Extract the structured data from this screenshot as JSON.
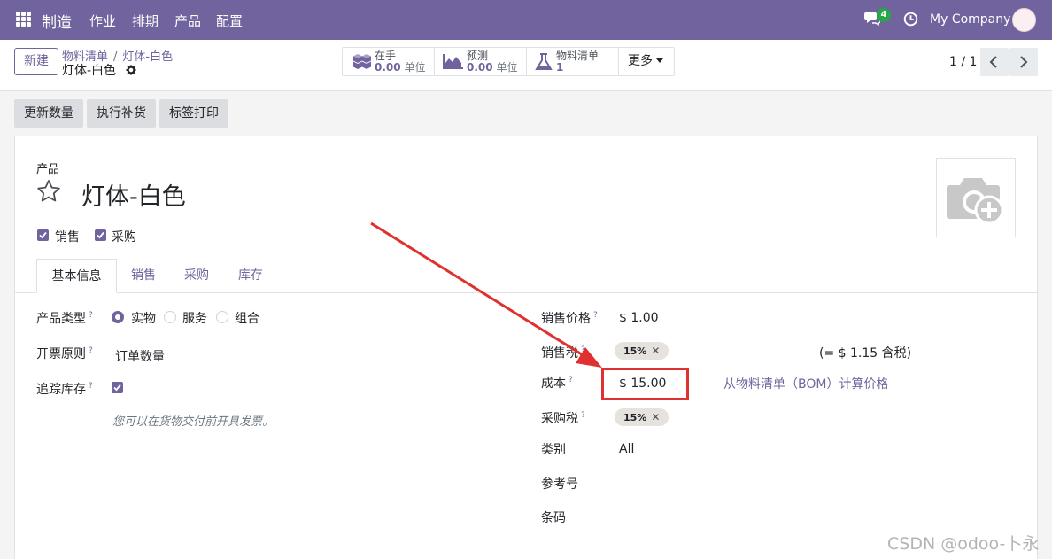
{
  "navbar": {
    "brand": "制造",
    "menu": [
      "作业",
      "排期",
      "产品",
      "配置"
    ],
    "chat_count": "4",
    "company": "My Company"
  },
  "control": {
    "new_label": "新建",
    "breadcrumb": [
      "物料清单",
      "灯体-白色"
    ],
    "record_title": "灯体-白色",
    "smart_buttons": [
      {
        "label": "在手",
        "value": "0.00",
        "unit": "单位",
        "icon": "cubes-icon"
      },
      {
        "label": "预测",
        "value": "0.00",
        "unit": "单位",
        "icon": "area-chart-icon"
      },
      {
        "label": "物料清单",
        "value": "1",
        "unit": "",
        "icon": "flask-icon"
      }
    ],
    "more_label": "更多",
    "pager": "1 / 1"
  },
  "actions": [
    "更新数量",
    "执行补货",
    "标签打印"
  ],
  "form": {
    "product_label": "产品",
    "product_name": "灯体-白色",
    "sale_ok_label": "销售",
    "purchase_ok_label": "采购",
    "tabs": [
      "基本信息",
      "销售",
      "采购",
      "库存"
    ],
    "left": {
      "type_label": "产品类型",
      "type_options": [
        "实物",
        "服务",
        "组合"
      ],
      "type_selected": "实物",
      "invoice_label": "开票原则",
      "invoice_value": "订单数量",
      "track_label": "追踪库存",
      "hint": "您可以在货物交付前开具发票。"
    },
    "right": {
      "price_label": "销售价格",
      "price_value": "$ 1.00",
      "sale_tax_label": "销售税",
      "sale_tax_tag": "15%",
      "sale_tax_incl": "(= $ 1.15 含税)",
      "cost_label": "成本",
      "cost_value": "$ 15.00",
      "bom_link": "从物料清单（BOM）计算价格",
      "purchase_tax_label": "采购税",
      "purchase_tax_tag": "15%",
      "category_label": "类别",
      "category_value": "All",
      "ref_label": "参考号",
      "barcode_label": "条码"
    }
  },
  "watermark": "CSDN @odoo-卜永",
  "colors": {
    "brand": "#71639e",
    "annotation": "#e03131"
  }
}
